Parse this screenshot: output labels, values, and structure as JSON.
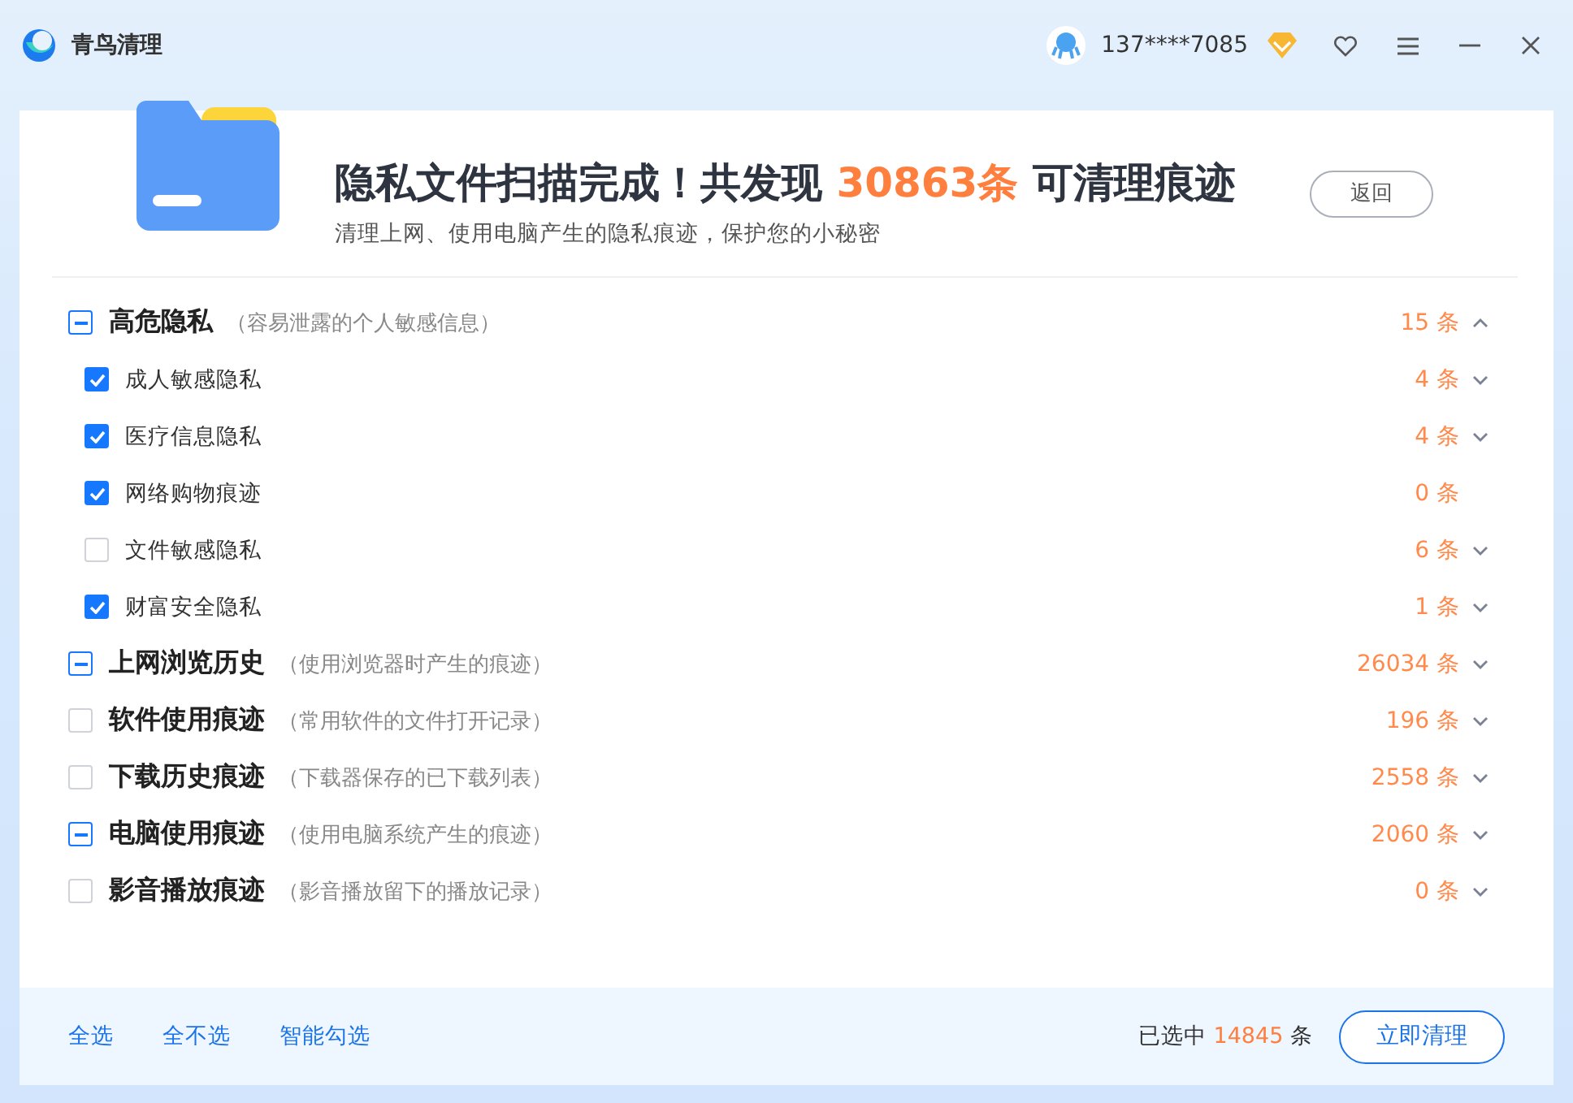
{
  "app": {
    "name": "青鸟清理"
  },
  "user": {
    "phone": "137****7085"
  },
  "header": {
    "title_before": "隐私文件扫描完成！共发现 ",
    "title_count": "30863条",
    "title_after": " 可清理痕迹",
    "subtitle": "清理上网、使用电脑产生的隐私痕迹，保护您的小秘密",
    "back_button": "返回"
  },
  "categories": [
    {
      "label": "高危隐私",
      "hint": "（容易泄露的个人敏感信息）",
      "checked": false,
      "indeterminate": true,
      "count": "15 条",
      "expanded": true,
      "children": [
        {
          "label": "成人敏感隐私",
          "checked": true,
          "count": "4 条",
          "expandable": true
        },
        {
          "label": "医疗信息隐私",
          "checked": true,
          "count": "4 条",
          "expandable": true
        },
        {
          "label": "网络购物痕迹",
          "checked": true,
          "count": "0 条",
          "expandable": false
        },
        {
          "label": "文件敏感隐私",
          "checked": false,
          "count": "6 条",
          "expandable": true
        },
        {
          "label": "财富安全隐私",
          "checked": true,
          "count": "1 条",
          "expandable": true
        }
      ]
    },
    {
      "label": "上网浏览历史",
      "hint": "（使用浏览器时产生的痕迹）",
      "checked": false,
      "indeterminate": true,
      "count": "26034 条",
      "expanded": false
    },
    {
      "label": "软件使用痕迹",
      "hint": "（常用软件的文件打开记录）",
      "checked": false,
      "indeterminate": false,
      "count": "196 条",
      "expanded": false
    },
    {
      "label": "下载历史痕迹",
      "hint": "（下载器保存的已下载列表）",
      "checked": false,
      "indeterminate": false,
      "count": "2558 条",
      "expanded": false
    },
    {
      "label": "电脑使用痕迹",
      "hint": "（使用电脑系统产生的痕迹）",
      "checked": false,
      "indeterminate": true,
      "count": "2060 条",
      "expanded": false
    },
    {
      "label": "影音播放痕迹",
      "hint": "（影音播放留下的播放记录）",
      "checked": false,
      "indeterminate": false,
      "count": "0 条",
      "expanded": false
    }
  ],
  "footer": {
    "links": [
      "全选",
      "全不选",
      "智能勾选"
    ],
    "selected_prefix": "已选中",
    "selected_count": "14845",
    "selected_suffix": "条",
    "clean_button": "立即清理"
  }
}
